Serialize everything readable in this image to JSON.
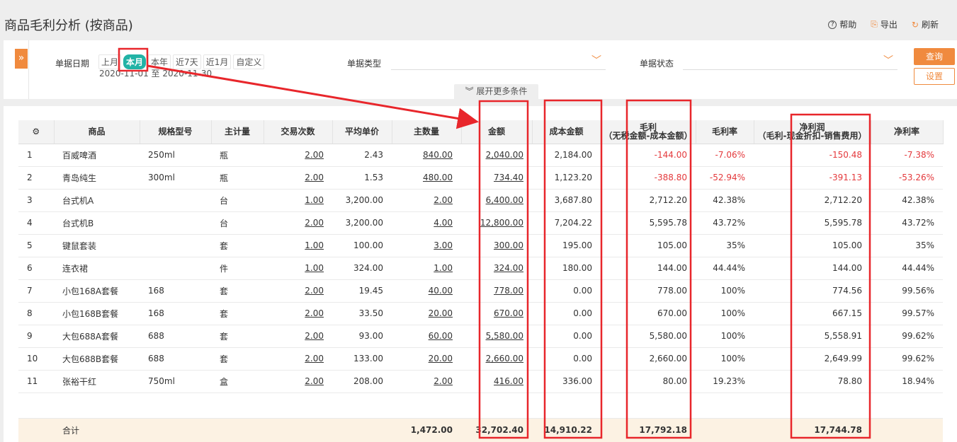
{
  "page": {
    "title": "商品毛利分析 (按商品)"
  },
  "actions": {
    "help": "帮助",
    "export": "导出",
    "refresh": "刷新"
  },
  "filter": {
    "date_label": "单据日期",
    "quick": [
      "上月",
      "本月",
      "本年",
      "近7天",
      "近1月",
      "自定义"
    ],
    "active_quick": "本月",
    "date_range": "2020-11-01 至 2020-11-30",
    "type_label": "单据类型",
    "type_value": "",
    "status_label": "单据状态",
    "status_value": "",
    "query": "查询",
    "settings": "设置",
    "more": "展开更多条件"
  },
  "table": {
    "headers": {
      "settings_icon": "gear-icon",
      "product": "商品",
      "spec": "规格型号",
      "unit": "主计量",
      "trades": "交易次数",
      "avg_price": "平均单价",
      "qty": "主数量",
      "amount": "金额",
      "cost": "成本金额",
      "gp_title": "毛利",
      "gp_sub": "（无税金额-成本金额）",
      "gp_rate": "毛利率",
      "np_title": "净利润",
      "np_sub": "（毛利-现金折扣-销售费用）",
      "np_rate": "净利率"
    },
    "rows": [
      {
        "no": "1",
        "product": "百威啤酒",
        "spec": "250ml",
        "unit": "瓶",
        "trades": "2.00",
        "avg_price": "2.43",
        "qty": "840.00",
        "amount": "2,040.00",
        "cost": "2,184.00",
        "gp": "-144.00",
        "gp_rate": "-7.06%",
        "np": "-150.48",
        "np_rate": "-7.38%"
      },
      {
        "no": "2",
        "product": "青岛纯生",
        "spec": "300ml",
        "unit": "瓶",
        "trades": "2.00",
        "avg_price": "1.53",
        "qty": "480.00",
        "amount": "734.40",
        "cost": "1,123.20",
        "gp": "-388.80",
        "gp_rate": "-52.94%",
        "np": "-391.13",
        "np_rate": "-53.26%"
      },
      {
        "no": "3",
        "product": "台式机A",
        "spec": "",
        "unit": "台",
        "trades": "1.00",
        "avg_price": "3,200.00",
        "qty": "2.00",
        "amount": "6,400.00",
        "cost": "3,687.80",
        "gp": "2,712.20",
        "gp_rate": "42.38%",
        "np": "2,712.20",
        "np_rate": "42.38%"
      },
      {
        "no": "4",
        "product": "台式机B",
        "spec": "",
        "unit": "台",
        "trades": "2.00",
        "avg_price": "3,200.00",
        "qty": "4.00",
        "amount": "12,800.00",
        "cost": "7,204.22",
        "gp": "5,595.78",
        "gp_rate": "43.72%",
        "np": "5,595.78",
        "np_rate": "43.72%"
      },
      {
        "no": "5",
        "product": "键鼠套装",
        "spec": "",
        "unit": "套",
        "trades": "1.00",
        "avg_price": "100.00",
        "qty": "3.00",
        "amount": "300.00",
        "cost": "195.00",
        "gp": "105.00",
        "gp_rate": "35%",
        "np": "105.00",
        "np_rate": "35%"
      },
      {
        "no": "6",
        "product": "连衣裙",
        "spec": "",
        "unit": "件",
        "trades": "1.00",
        "avg_price": "324.00",
        "qty": "1.00",
        "amount": "324.00",
        "cost": "180.00",
        "gp": "144.00",
        "gp_rate": "44.44%",
        "np": "144.00",
        "np_rate": "44.44%"
      },
      {
        "no": "7",
        "product": "小包168A套餐",
        "spec": "168",
        "unit": "套",
        "trades": "2.00",
        "avg_price": "19.45",
        "qty": "40.00",
        "amount": "778.00",
        "cost": "0.00",
        "gp": "778.00",
        "gp_rate": "100%",
        "np": "774.56",
        "np_rate": "99.56%"
      },
      {
        "no": "8",
        "product": "小包168B套餐",
        "spec": "168",
        "unit": "套",
        "trades": "2.00",
        "avg_price": "33.50",
        "qty": "20.00",
        "amount": "670.00",
        "cost": "0.00",
        "gp": "670.00",
        "gp_rate": "100%",
        "np": "667.15",
        "np_rate": "99.57%"
      },
      {
        "no": "9",
        "product": "大包688A套餐",
        "spec": "688",
        "unit": "套",
        "trades": "2.00",
        "avg_price": "93.00",
        "qty": "60.00",
        "amount": "5,580.00",
        "cost": "0.00",
        "gp": "5,580.00",
        "gp_rate": "100%",
        "np": "5,558.91",
        "np_rate": "99.62%"
      },
      {
        "no": "10",
        "product": "大包688B套餐",
        "spec": "688",
        "unit": "套",
        "trades": "2.00",
        "avg_price": "133.00",
        "qty": "20.00",
        "amount": "2,660.00",
        "cost": "0.00",
        "gp": "2,660.00",
        "gp_rate": "100%",
        "np": "2,649.99",
        "np_rate": "99.62%"
      },
      {
        "no": "11",
        "product": "张裕干红",
        "spec": "750ml",
        "unit": "盒",
        "trades": "2.00",
        "avg_price": "208.00",
        "qty": "2.00",
        "amount": "416.00",
        "cost": "336.00",
        "gp": "80.00",
        "gp_rate": "19.23%",
        "np": "78.80",
        "np_rate": "18.94%"
      }
    ],
    "total": {
      "label": "合计",
      "qty": "1,472.00",
      "amount": "32,702.40",
      "cost": "14,910.22",
      "gp": "17,792.18",
      "np": "17,744.78"
    }
  },
  "colors": {
    "accent": "#f08a3e",
    "active_chip": "#22b3a6",
    "negative": "#e4393c",
    "annotation": "#e8262b",
    "total_row": "#fcf2e3"
  }
}
